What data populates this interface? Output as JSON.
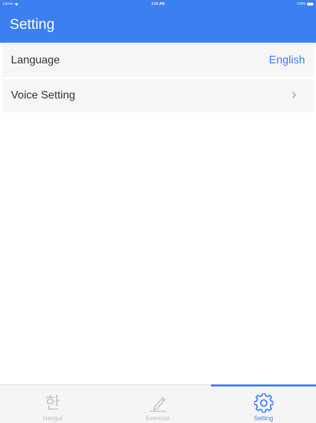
{
  "status_bar": {
    "carrier": "Carrier",
    "time": "2:01 AM",
    "battery": "100%"
  },
  "header": {
    "title": "Setting"
  },
  "settings": [
    {
      "label": "Language",
      "value": "English"
    },
    {
      "label": "Voice Setting"
    }
  ],
  "tabs": [
    {
      "label": "Hangul",
      "glyph": "한",
      "icon": "hangul-icon"
    },
    {
      "label": "Exercise",
      "icon": "pencil-icon"
    },
    {
      "label": "Setting",
      "icon": "gear-icon",
      "active": true
    }
  ],
  "colors": {
    "accent": "#3b7ff0",
    "inactive": "#bdbdbd",
    "row_background": "#f6f6f6"
  }
}
